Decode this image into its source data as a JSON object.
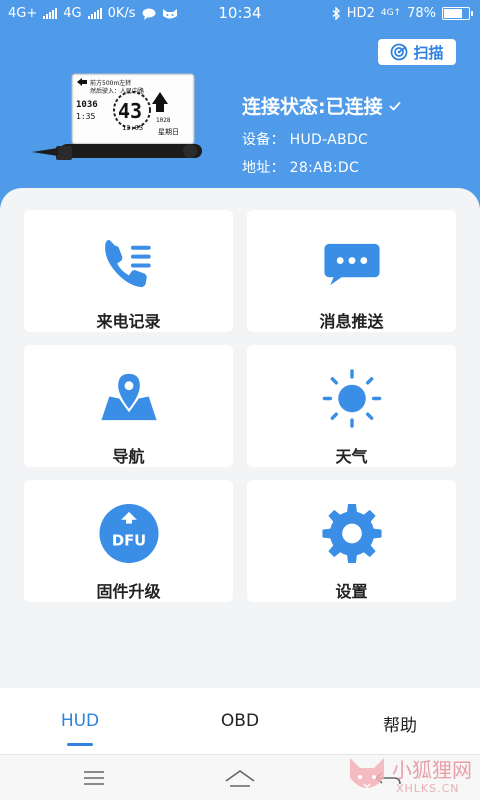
{
  "status_bar": {
    "left_text": [
      "4G+",
      "4G",
      "0K/s"
    ],
    "time": "10:34",
    "right_network": "HD2",
    "right_4g": "4G↑",
    "battery": "78%",
    "battery_level": 0.78,
    "left_icons": [
      "signal-icon",
      "signal-icon",
      "chat-bubble-icon",
      "cat-icon"
    ],
    "right_icons": [
      "bluetooth-icon",
      "battery-icon"
    ]
  },
  "header": {
    "scan_label": "扫描",
    "scan_icon": "radar-icon",
    "connection_status": "连接状态:已连接",
    "device_line": "设备： HUD-ABDC",
    "address_line": "地址： 28:AB:DC",
    "device_screen": {
      "top_text": "前方500m左转",
      "sub_text": "然后驶入：人民中路",
      "left_num": "1036",
      "left_num2": "1:35",
      "speed": "43",
      "clock": "13:03",
      "right_num": "1028",
      "weekday": "星期日"
    }
  },
  "tiles": [
    {
      "label": "来电记录",
      "icon": "phone-list-icon"
    },
    {
      "label": "消息推送",
      "icon": "message-bubble-icon"
    },
    {
      "label": "导航",
      "icon": "map-pin-icon"
    },
    {
      "label": "天气",
      "icon": "sun-icon"
    },
    {
      "label": "固件升级",
      "icon": "dfu-upgrade-icon",
      "icon_text": "DFU"
    },
    {
      "label": "设置",
      "icon": "gear-icon"
    }
  ],
  "bottom_nav": [
    {
      "label": "HUD",
      "active": true
    },
    {
      "label": "OBD",
      "active": false
    },
    {
      "label": "帮助",
      "active": false
    }
  ],
  "system_nav": [
    "menu-icon",
    "home-icon",
    "back-icon"
  ],
  "watermark": {
    "text": "小狐狸网",
    "sub": "XHLKS.CN"
  },
  "colors": {
    "primary": "#4f9bea",
    "accent": "#2f82e0",
    "icon_blue": "#3a8ee6",
    "background": "#f3f4f6"
  }
}
